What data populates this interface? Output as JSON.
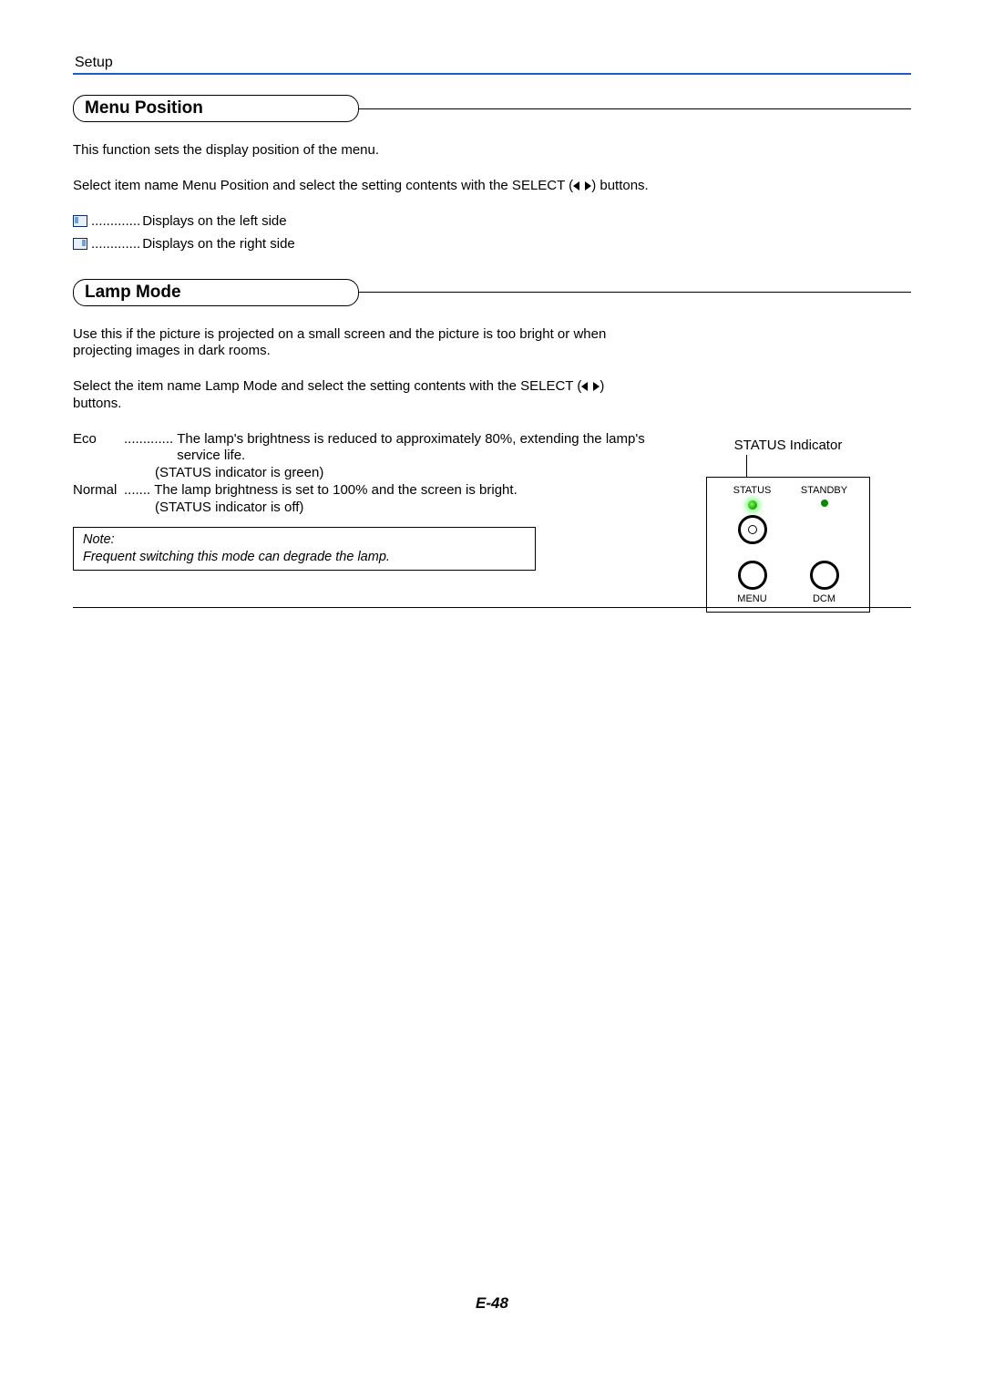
{
  "page": {
    "title": "Setup",
    "footer": "E-48"
  },
  "sections": {
    "menu_position": {
      "heading": "Menu Position",
      "intro": "This function sets the display position of the menu.",
      "instruction_pre": "Select item name  Menu Position  and select the setting contents with the SELECT (",
      "instruction_post": ") buttons.",
      "options": {
        "left": "Displays on the left side",
        "right": "Displays on the right side"
      },
      "dots": "............."
    },
    "lamp_mode": {
      "heading": "Lamp Mode",
      "intro": "Use this if the picture is projected on a small screen and the picture is too bright or when projecting images in dark rooms.",
      "instruction_pre": "Select the item name  Lamp Mode  and select the setting contents with the SELECT (",
      "instruction_post": ") buttons.",
      "modes": {
        "eco": {
          "label": "Eco",
          "dots": ".............",
          "line1": "The lamp's brightness is reduced to approximately 80%, extending the lamp's service life.",
          "line2": "(STATUS indicator is green)"
        },
        "normal": {
          "label": "Normal",
          "dots": ".......",
          "line1": "The lamp brightness is set to 100% and the screen is bright.",
          "line2": "(STATUS indicator is off)"
        }
      },
      "note_label": "Note:",
      "note_body": "Frequent switching this mode can degrade the lamp."
    }
  },
  "indicator": {
    "caption": "STATUS Indicator",
    "labels": {
      "status": "STATUS",
      "standby": "STANDBY",
      "menu": "MENU",
      "dcm": "DCM"
    }
  }
}
